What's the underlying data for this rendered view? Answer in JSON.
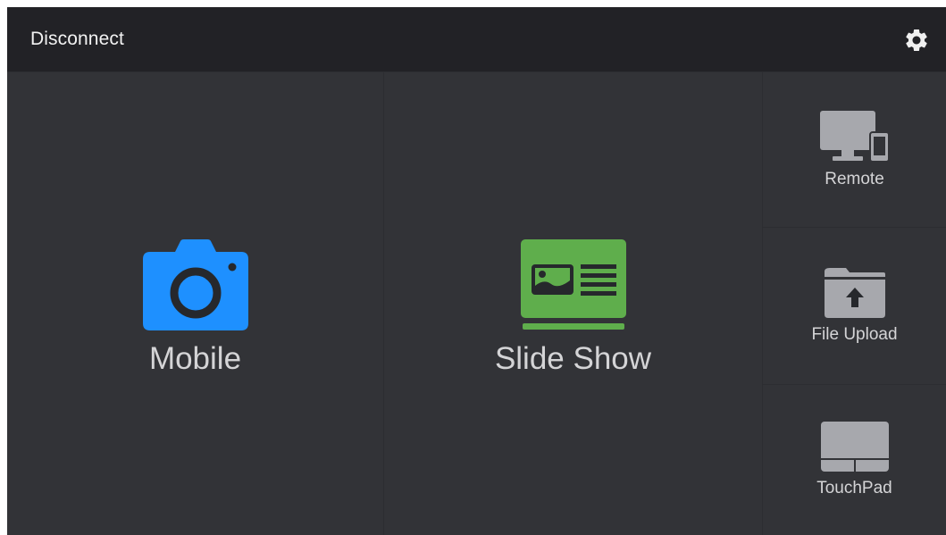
{
  "header": {
    "disconnect_label": "Disconnect",
    "settings_icon": "gear-icon"
  },
  "tiles": {
    "mobile": {
      "label": "Mobile",
      "icon": "camera-icon",
      "icon_color": "#1e90ff"
    },
    "slideshow": {
      "label": "Slide Show",
      "icon": "slideshow-icon",
      "icon_color": "#5fae4c"
    },
    "remote": {
      "label": "Remote",
      "icon": "monitor-phone-icon"
    },
    "file_upload": {
      "label": "File Upload",
      "icon": "folder-upload-icon"
    },
    "touchpad": {
      "label": "TouchPad",
      "icon": "touchpad-icon"
    }
  },
  "colors": {
    "background": "#2c2d31",
    "header": "#222226",
    "tile": "#323337",
    "text": "#d4d4d6",
    "icon_gray": "#a7a8ad"
  }
}
